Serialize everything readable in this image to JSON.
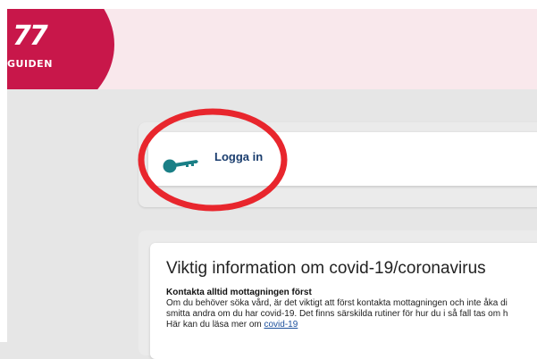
{
  "brand": {
    "logo_number": "77",
    "logo_text": "GUIDEN",
    "color": "#c8174a",
    "header_bg": "#f9e8ec"
  },
  "login": {
    "label": "Logga in",
    "icon": "key-icon",
    "icon_color": "#1a7f86"
  },
  "annotation": {
    "color": "#e8262d"
  },
  "info": {
    "title": "Viktig information om covid-19/coronavirus",
    "subtitle": "Kontakta alltid mottagningen först",
    "line1": "Om du behöver söka vård, är det viktigt att först kontakta mottagningen och inte åka di",
    "line2": "smitta andra om du har covid-19. Det finns särskilda rutiner för hur du i så fall tas om h",
    "line3_prefix": "Här kan du läsa mer om ",
    "line3_link": "covid-19",
    "link_color": "#1b4f9c"
  }
}
